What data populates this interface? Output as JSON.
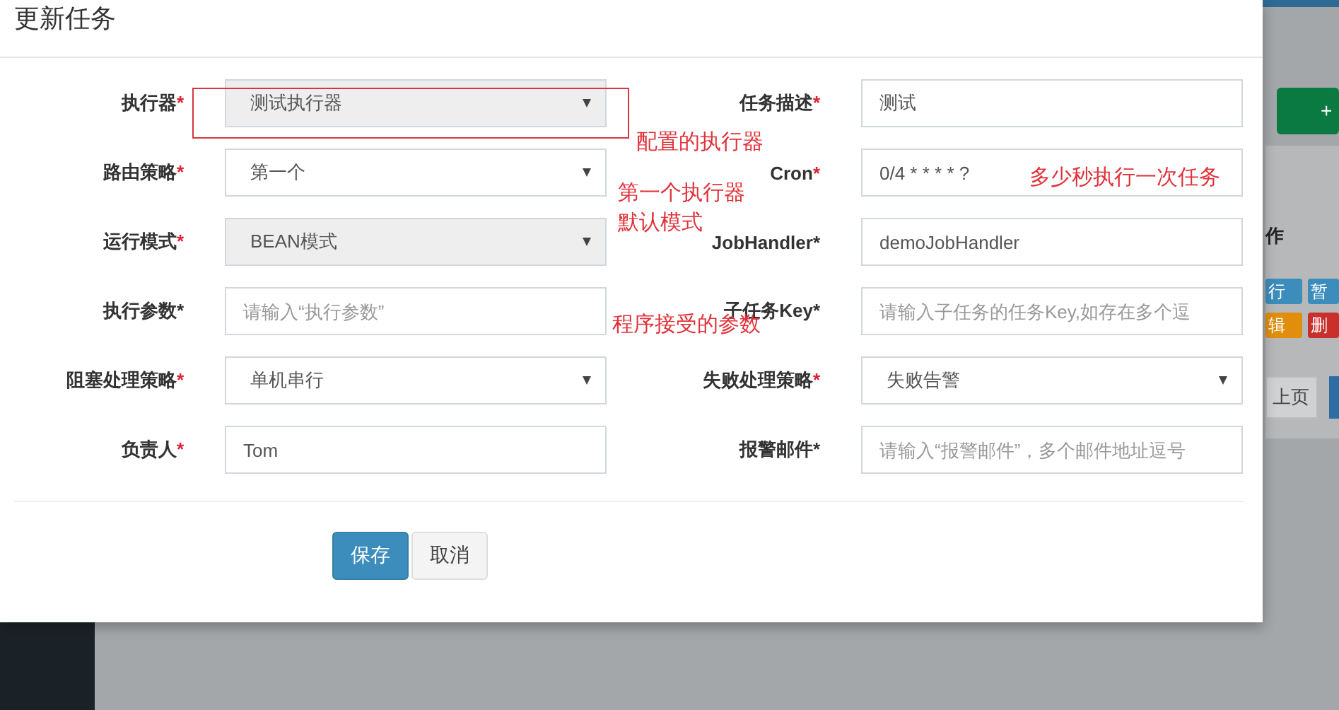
{
  "background": {
    "add_button": "+",
    "column_header": "作",
    "row_buttons": [
      {
        "label": "行",
        "kind": "run"
      },
      {
        "label": "暂",
        "kind": "pause"
      },
      {
        "label": "辑",
        "kind": "edit"
      },
      {
        "label": "删",
        "kind": "delete"
      }
    ],
    "pager": "上页"
  },
  "dialog": {
    "title": "更新任务",
    "fields": [
      {
        "label": "执行器",
        "star": "*",
        "star_red": true,
        "kind": "select",
        "value": "测试执行器",
        "disabled": true
      },
      {
        "label": "任务描述",
        "star": "*",
        "star_red": true,
        "kind": "input",
        "value": "测试",
        "disabled": false
      },
      {
        "label": "路由策略",
        "star": "*",
        "star_red": true,
        "kind": "select",
        "value": "第一个",
        "disabled": false
      },
      {
        "label": "Cron",
        "star": "*",
        "star_red": true,
        "kind": "input",
        "value": "0/4 * * * * ?",
        "disabled": false
      },
      {
        "label": "运行模式",
        "star": "*",
        "star_red": true,
        "kind": "select",
        "value": "BEAN模式",
        "disabled": true
      },
      {
        "label": "JobHandler",
        "star": "*",
        "star_red": false,
        "kind": "input",
        "value": "demoJobHandler",
        "disabled": false
      },
      {
        "label": "执行参数",
        "star": "*",
        "star_red": false,
        "kind": "input",
        "placeholder": "请输入“执行参数”",
        "disabled": false
      },
      {
        "label": "子任务Key",
        "star": "*",
        "star_red": false,
        "kind": "input",
        "placeholder": "请输入子任务的任务Key,如存在多个逗",
        "disabled": false
      },
      {
        "label": "阻塞处理策略",
        "star": "*",
        "star_red": true,
        "kind": "select",
        "value": "单机串行",
        "disabled": false
      },
      {
        "label": "失败处理策略",
        "star": "*",
        "star_red": true,
        "kind": "select",
        "value": "失败告警",
        "disabled": false
      },
      {
        "label": "负责人",
        "star": "*",
        "star_red": true,
        "kind": "input",
        "value": "Tom",
        "disabled": false
      },
      {
        "label": "报警邮件",
        "star": "*",
        "star_red": false,
        "kind": "input",
        "placeholder": "请输入“报警邮件”，多个邮件地址逗号",
        "disabled": false
      }
    ],
    "buttons": [
      {
        "label": "保存",
        "kind": "primary"
      },
      {
        "label": "取消",
        "kind": "default"
      }
    ]
  },
  "annotations": [
    {
      "kind": "box"
    },
    {
      "kind": "text",
      "text": "配置的执行器"
    },
    {
      "kind": "text",
      "text": "第一个执行器"
    },
    {
      "kind": "text",
      "text": "默认模式"
    },
    {
      "kind": "text",
      "text": "程序接受的参数"
    },
    {
      "kind": "text",
      "text": "多少秒执行一次任务"
    }
  ]
}
